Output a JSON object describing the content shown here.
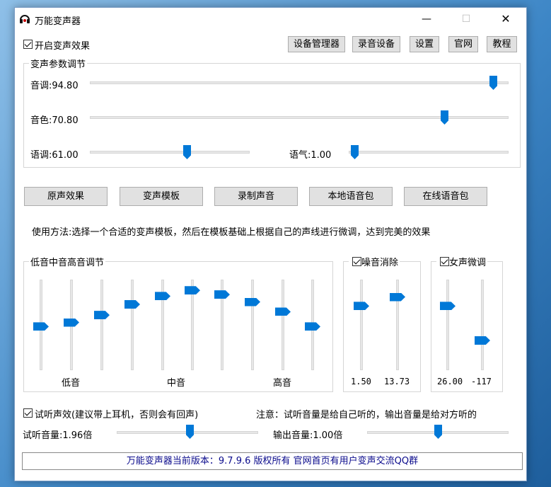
{
  "window": {
    "title": "万能变声器",
    "min_glyph": "—",
    "max_glyph": "☐",
    "close_glyph": "✕",
    "icon": "headphones-icon"
  },
  "enable": {
    "label": "开启变声效果",
    "checked": true
  },
  "toolbar": {
    "device_manager": "设备管理器",
    "record_device": "录音设备",
    "settings": "设置",
    "website": "官网",
    "tutorial": "教程"
  },
  "params": {
    "title": "变声参数调节",
    "pitch": {
      "label": "音调:94.80",
      "value": 94.8
    },
    "timbre": {
      "label": "音色:70.80",
      "value": 70.8
    },
    "intonation": {
      "label": "语调:61.00",
      "value": 61.0
    },
    "tone": {
      "label": "语气:1.00",
      "value": 1.0
    }
  },
  "buttons": {
    "original": "原声效果",
    "template": "变声模板",
    "record": "录制声音",
    "local_pack": "本地语音包",
    "online_pack": "在线语音包"
  },
  "usage": "使用方法:选择一个合适的变声模板，然后在模板基础上根据自己的声线进行微调，达到完美的效果",
  "eq": {
    "title": "低音中音高音调节",
    "bass": "低音",
    "mid": "中音",
    "treble": "高音",
    "levels": [
      0.52,
      0.47,
      0.38,
      0.25,
      0.15,
      0.08,
      0.13,
      0.22,
      0.34,
      0.52
    ]
  },
  "noise": {
    "label": "噪音消除",
    "checked": true,
    "v1": "1.50",
    "v2": "13.73",
    "levels": [
      0.27,
      0.16
    ]
  },
  "female": {
    "label": "女声微调",
    "checked": true,
    "v1": "26.00",
    "v2": "-117",
    "levels": [
      0.27,
      0.69
    ]
  },
  "monitor": {
    "label": "试听声效(建议带上耳机，否则会有回声)",
    "checked": true,
    "note": "注意：试听音量是给自己听的，输出音量是给对方听的",
    "listen_volume": "试听音量:1.96倍",
    "output_volume": "输出音量:1.00倍",
    "listen_level": 0.52,
    "output_level": 0.51
  },
  "status": "万能变声器当前版本：9.7.9.6  版权所有  官网首页有用户变声交流QQ群"
}
